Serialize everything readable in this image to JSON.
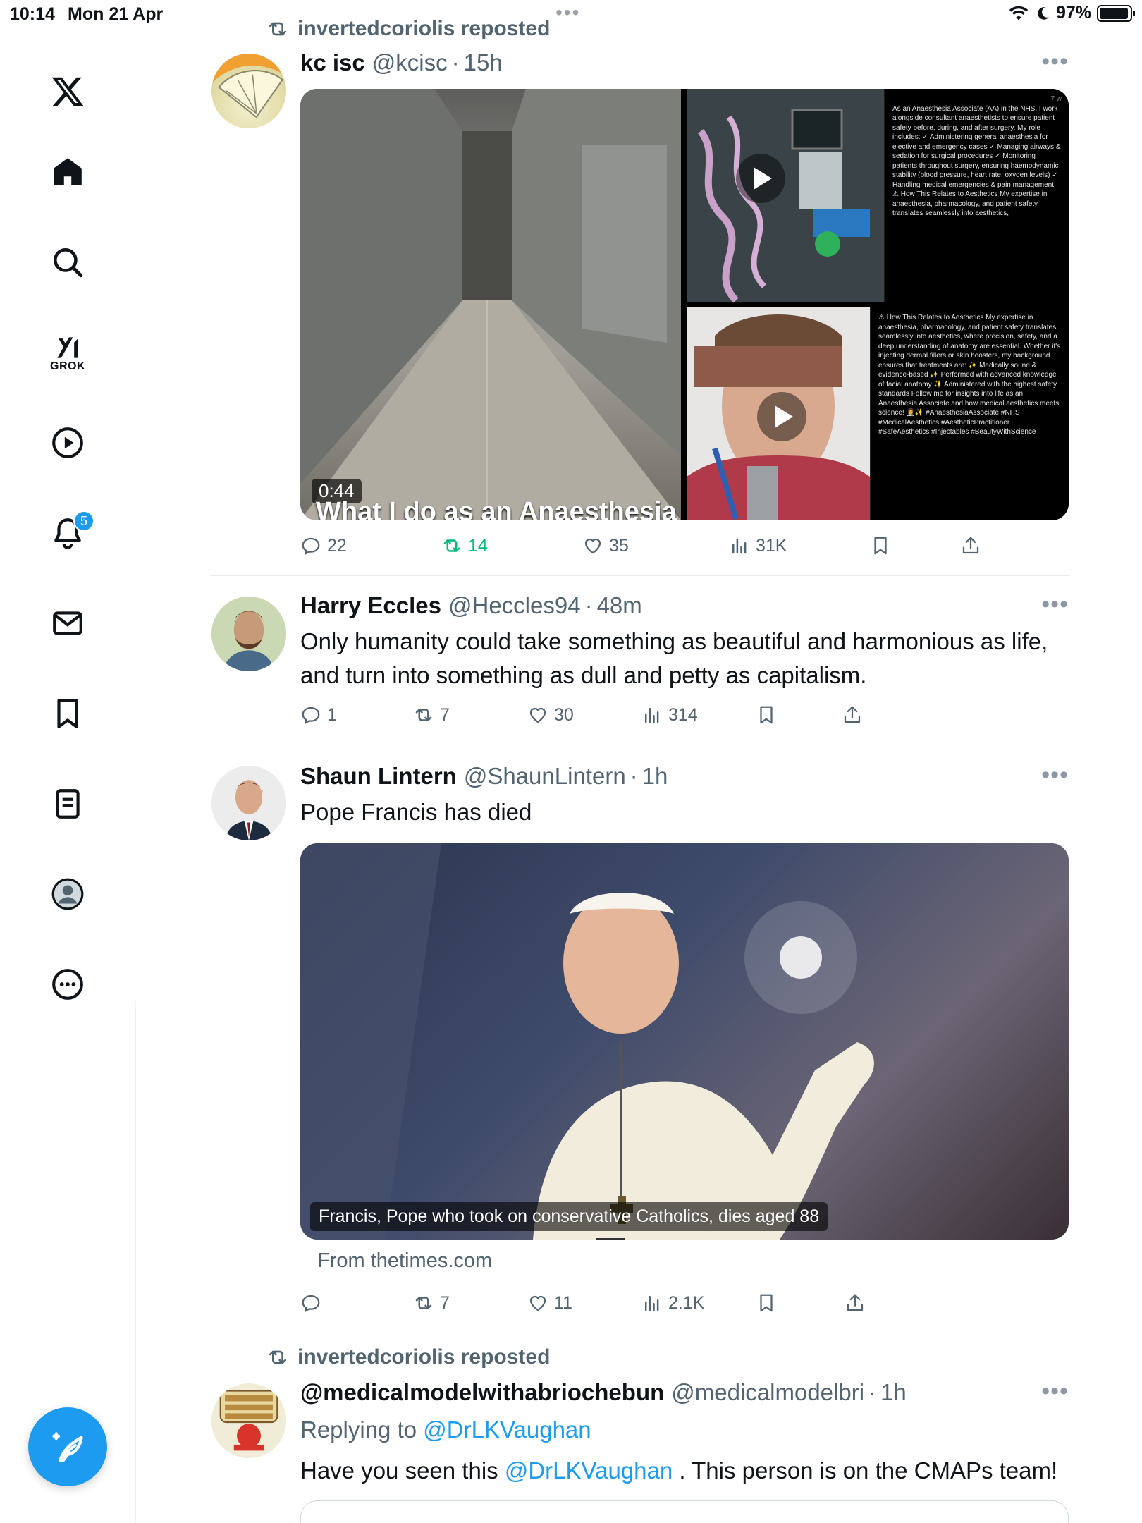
{
  "status_bar": {
    "time": "10:14",
    "date": "Mon 21 Apr",
    "battery": "97%"
  },
  "sidebar": {
    "items": [
      {
        "name": "x-logo-icon"
      },
      {
        "name": "home-icon"
      },
      {
        "name": "search-icon"
      },
      {
        "name": "grok-icon",
        "label": "GROK"
      },
      {
        "name": "video-icon"
      },
      {
        "name": "notifications-icon",
        "badge": "5"
      },
      {
        "name": "messages-icon"
      },
      {
        "name": "bookmarks-icon"
      },
      {
        "name": "lists-icon"
      },
      {
        "name": "profile-icon"
      },
      {
        "name": "more-icon"
      }
    ]
  },
  "tweets": [
    {
      "repost_label": "invertedcoriolis reposted",
      "name": "kc isc",
      "handle": "@kcisc",
      "time": "15h",
      "media": {
        "duration": "0:44",
        "overlay": "What I do as an Anaesthesia",
        "phone_header": "7 w",
        "phone_text_1": "As an Anaesthesia Associate (AA) in the NHS, I work alongside consultant anaesthetists to ensure patient safety before, during, and after surgery. My role includes: ✓ Administering general anaesthesia for elective and emergency cases ✓ Managing airways & sedation for surgical procedures ✓ Monitoring patients throughout surgery, ensuring haemodynamic stability (blood pressure, heart rate, oxygen levels) ✓ Handling medical emergencies & pain management ⚠ How This Relates to Aesthetics My expertise in anaesthesia, pharmacology, and patient safety translates seamlessly into aesthetics,",
        "phone_text_2": "⚠ How This Relates to Aesthetics My expertise in anaesthesia, pharmacology, and patient safety translates seamlessly into aesthetics, where precision, safety, and a deep understanding of anatomy are essential. Whether it's injecting dermal fillers or skin boosters, my background ensures that treatments are: ✨ Medically sound & evidence-based ✨ Performed with advanced knowledge of facial anatomy ✨ Administered with the highest safety standards Follow me for insights into life as an Anaesthesia Associate and how medical aesthetics meets science! 👩‍⚕️✨ #AnaesthesiaAssociate #NHS #MedicalAesthetics #AestheticPractitioner #SafeAesthetics #Injectables #BeautyWithScience"
      },
      "stats": {
        "replies": "22",
        "reposts": "14",
        "likes": "35",
        "views": "31K"
      }
    },
    {
      "name": "Harry Eccles",
      "handle": "@Heccles94",
      "time": "48m",
      "text": "Only humanity could take something as beautiful and harmonious as life, and turn into something as dull and petty as capitalism.",
      "stats": {
        "replies": "1",
        "reposts": "7",
        "likes": "30",
        "views": "314"
      }
    },
    {
      "name": "Shaun Lintern",
      "handle": "@ShaunLintern",
      "time": "1h",
      "text": "Pope Francis has died",
      "card_caption": "Francis, Pope who took on conservative Catholics, dies aged 88",
      "card_source": "From thetimes.com",
      "stats": {
        "replies": "",
        "reposts": "7",
        "likes": "11",
        "views": "2.1K"
      }
    },
    {
      "repost_label": "invertedcoriolis reposted",
      "name": "@medicalmodelwithabriochebun",
      "handle": "@medicalmodelbri",
      "time": "1h",
      "replying_prefix": "Replying to ",
      "replying_to": "@DrLKVaughan",
      "text_1": "Have you seen this ",
      "text_mention": "@DrLKVaughan",
      "text_2": " . This person is on the CMAPs team!"
    }
  ],
  "colors": {
    "accent": "#1d9bf0",
    "secondary_text": "#536471",
    "repost_green": "#00ba7c"
  }
}
